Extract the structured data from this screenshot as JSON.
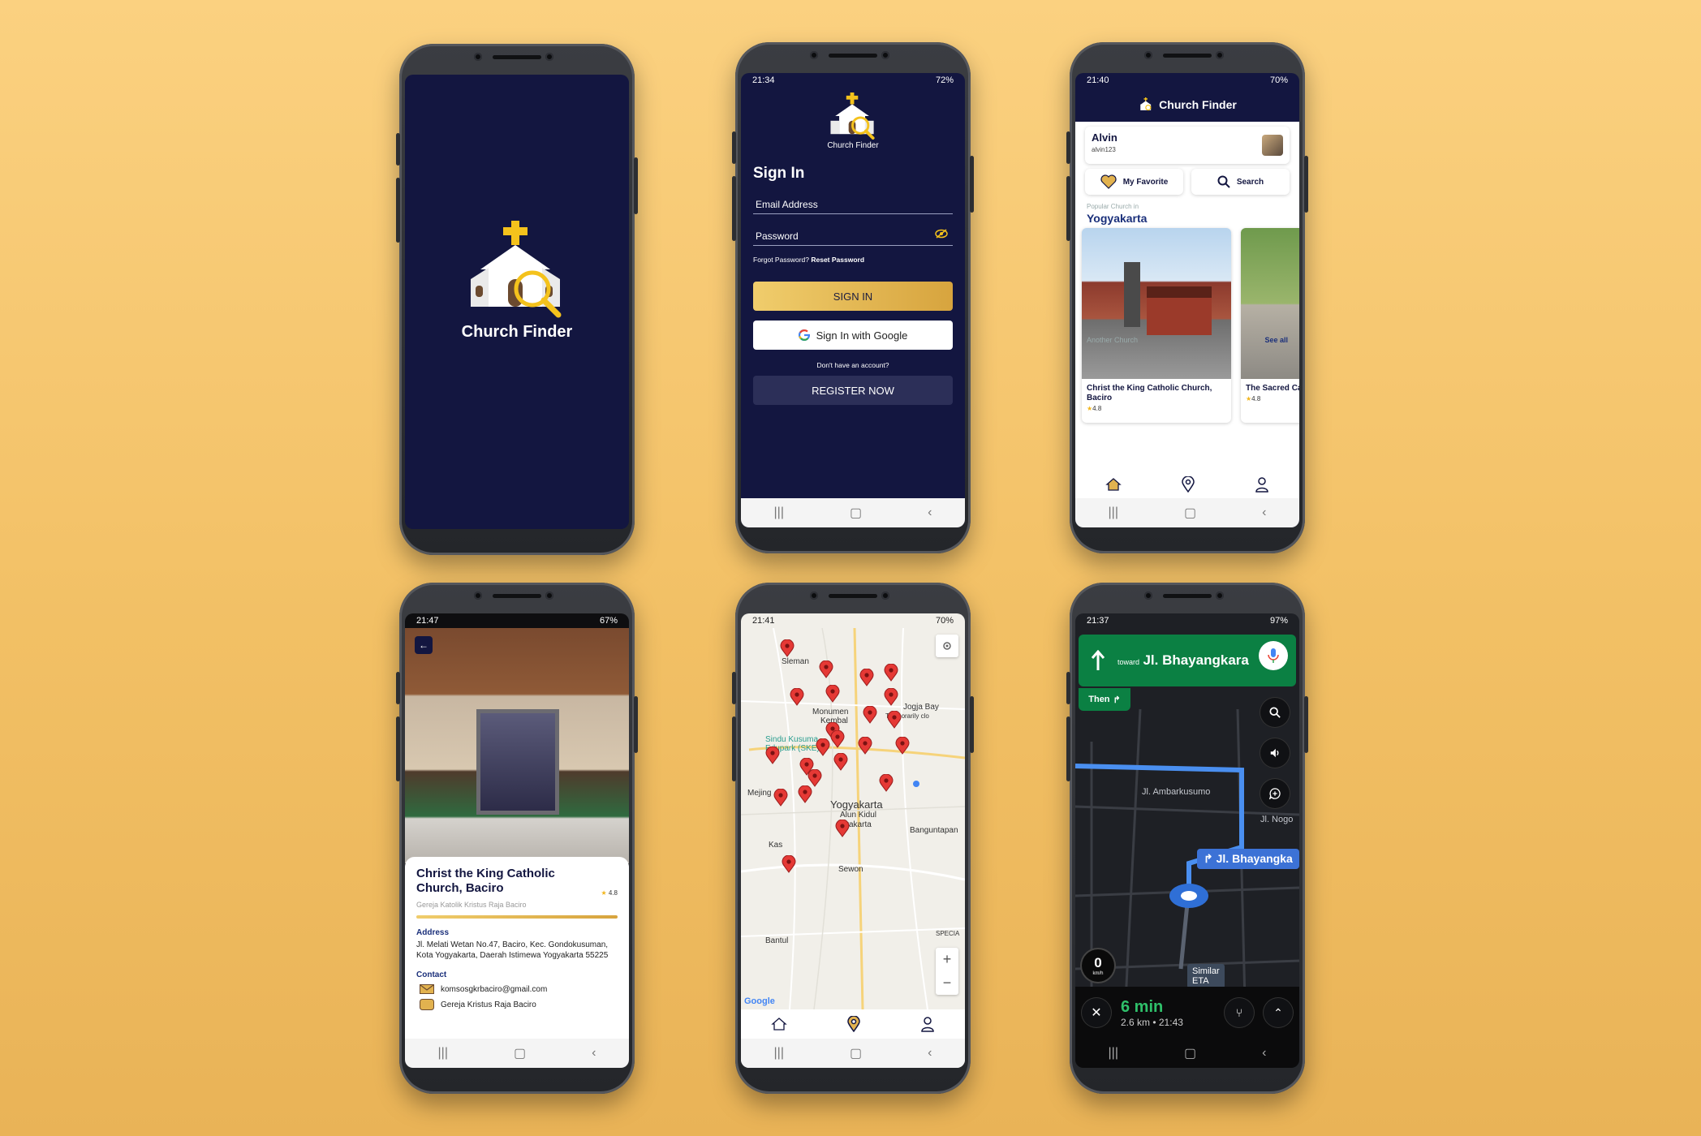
{
  "brand": {
    "name": "Church Finder"
  },
  "splash": {},
  "signin": {
    "status_time": "21:34",
    "battery": "72%",
    "title": "Sign In",
    "email_label": "Email Address",
    "password_label": "Password",
    "forgot_text": "Forgot Password?",
    "reset_link": "Reset Password",
    "signin_button": "SIGN IN",
    "google_button": "Sign In with Google",
    "no_account": "Don't have an account?",
    "register_button": "REGISTER NOW"
  },
  "home": {
    "status_time": "21:40",
    "battery": "70%",
    "user_name": "Alvin",
    "user_handle": "alvin123",
    "favorite_button": "My Favorite",
    "search_button": "Search",
    "popular_label": "Popular Church in",
    "city": "Yogyakarta",
    "churches": [
      {
        "name": "Christ the King Catholic Church, Baciro",
        "rating": "4.8"
      },
      {
        "name": "The Sacred Catholic Cl",
        "rating": "4.8"
      }
    ],
    "another_label": "Another Church",
    "see_all": "See all"
  },
  "detail": {
    "status_time": "21:47",
    "battery": "67%",
    "title": "Christ the King Catholic Church, Baciro",
    "rating": "4.8",
    "subtitle": "Gereja Katolik Kristus Raja Baciro",
    "address_label": "Address",
    "address": "Jl. Melati Wetan No.47, Baciro, Kec. Gondokusuman, Kota Yogyakarta, Daerah Istimewa Yogyakarta 55225",
    "contact_label": "Contact",
    "email": "komsosgkrbaciro@gmail.com",
    "social": "Gereja Kristus Raja Baciro"
  },
  "map": {
    "status_time": "21:41",
    "battery": "70%",
    "labels": [
      "Sleman",
      "Monumen",
      "Kembal",
      "Sindu Kusuma",
      "Edupark (SKE)",
      "Jogja Bay",
      "Temporarily clo",
      "Mejing",
      "Yogyakarta",
      "Alun Kidul",
      "yakarta",
      "Banguntapan",
      "Kas",
      "Sewon",
      "Bantul",
      "SPECIA"
    ],
    "google": "Google"
  },
  "nav": {
    "status_time": "21:37",
    "battery": "97%",
    "toward": "toward",
    "street": "Jl. Bhayangkara",
    "then": "Then",
    "street_ambar": "Jl. Ambarkusumo",
    "street_nogo": "Jl. Nogo",
    "street_tag": "Jl. Bhayangka",
    "speed": "0",
    "speed_unit": "km/h",
    "similar": "Similar\nETA",
    "eta_time": "6 min",
    "eta_meta": "2.6 km • 21:43"
  },
  "colors": {
    "navy": "#131640",
    "gold": "#e2b24f",
    "pin": "#e53935",
    "nav_green": "#0b8043"
  }
}
